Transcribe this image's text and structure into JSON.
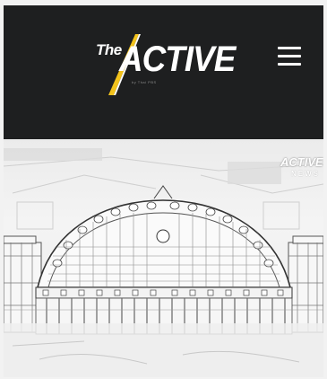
{
  "header": {
    "logo": {
      "prefix": "The",
      "name": "ACTIVE",
      "tagline": "by Thai PBS"
    },
    "menu_icon": "hamburger-menu-icon"
  },
  "hero": {
    "badge": {
      "name": "ACTIVE",
      "label": "NEWS"
    }
  },
  "colors": {
    "header_background": "#1e1f20",
    "logo_accent": "#f2c21b",
    "logo_text": "#ffffff"
  }
}
